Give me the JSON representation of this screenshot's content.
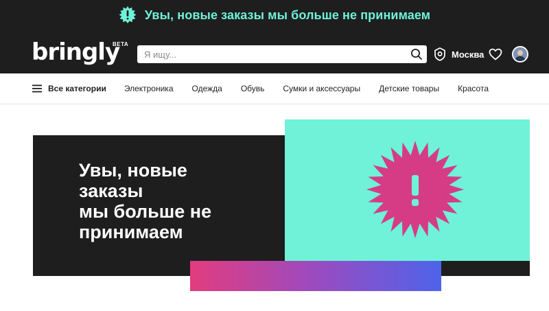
{
  "notice": {
    "text": "Увы, новые заказы мы больше не принимаем",
    "icon": "exclamation-badge-icon"
  },
  "header": {
    "logo_text": "bringly",
    "logo_badge": "BETA",
    "search": {
      "placeholder": "Я ищу...",
      "value": ""
    },
    "location": "Москва",
    "icons": [
      "search-icon",
      "location-pin-icon",
      "heart-icon",
      "avatar"
    ]
  },
  "categories": {
    "all_label": "Все категории",
    "items": [
      "Электроника",
      "Одежда",
      "Обувь",
      "Сумки и аксессуары",
      "Детские товары",
      "Красота"
    ]
  },
  "banner": {
    "title_lines": [
      "Увы, новые",
      "заказы",
      "мы больше не",
      "принимаем"
    ],
    "icon": "exclamation-burst-icon"
  },
  "colors": {
    "dark": "#1e1e1e",
    "mint": "#6ff2d8",
    "pink": "#d63c85",
    "gradient_start": "#e23c7e",
    "gradient_end": "#4e63ea"
  }
}
